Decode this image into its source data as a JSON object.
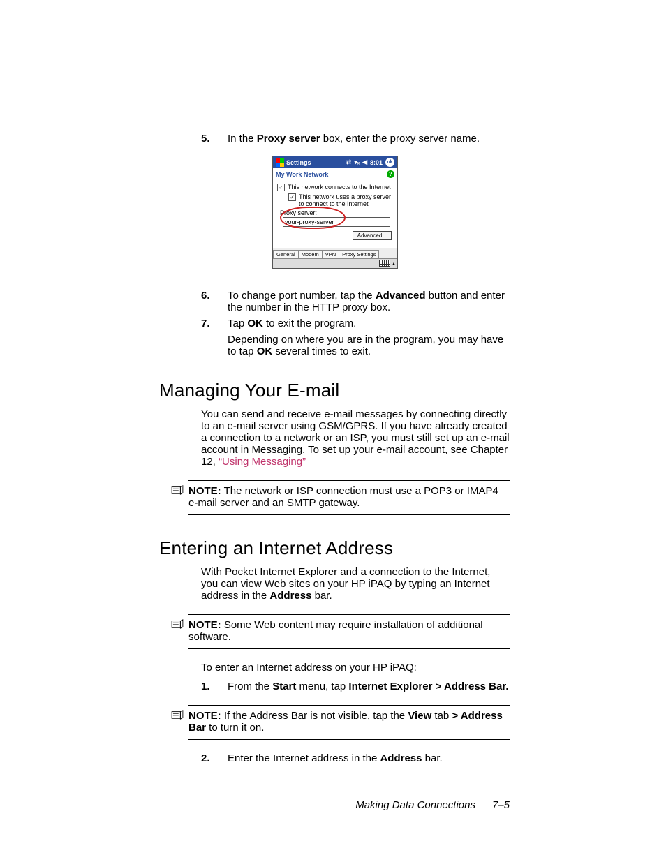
{
  "steps_a": [
    {
      "num": "5.",
      "pre": "In the ",
      "bold1": "Proxy server",
      "post": " box, enter the proxy server name."
    }
  ],
  "device": {
    "title": "Settings",
    "status_time": "8:01",
    "ok": "ok",
    "subtitle": "My Work Network",
    "help": "?",
    "check1": "This network connects to the Internet",
    "check2": "This network uses a proxy server to connect to the Internet",
    "proxy_label": "Proxy server:",
    "proxy_value": "your-proxy-server",
    "advanced": "Advanced...",
    "tabs": [
      "General",
      "Modem",
      "VPN",
      "Proxy Settings"
    ]
  },
  "steps_b": [
    {
      "num": "6.",
      "parts": [
        "To change port number, tap the ",
        "Advanced",
        " button and enter the number in the HTTP proxy box."
      ]
    },
    {
      "num": "7.",
      "parts": [
        "Tap ",
        "OK",
        " to exit the program."
      ],
      "tail": [
        "Depending on where you are in the program, you may have to tap ",
        "OK",
        " several times to exit."
      ]
    }
  ],
  "section1": {
    "title": "Managing Your E-mail",
    "para_parts": [
      "You can send and receive e-mail messages by connecting directly to an e-mail server using GSM/GPRS. If you have already created a connection to a network or an ISP, you must still set up an e-mail account in Messaging. To set up your e-mail account, see Chapter 12, ",
      "“Using Messaging”"
    ],
    "note": {
      "label": "NOTE:",
      "text": " The network or ISP connection must use a POP3 or IMAP4 e-mail server and an SMTP gateway."
    }
  },
  "section2": {
    "title": "Entering an Internet Address",
    "para1_parts": [
      "With Pocket Internet Explorer and a connection to the Internet, you can view Web sites on your HP iPAQ by typing an Internet address in the ",
      "Address",
      " bar."
    ],
    "note1": {
      "label": "NOTE:",
      "text": " Some Web content may require installation of additional software."
    },
    "lead": "To enter an Internet address on your HP iPAQ:",
    "step1": {
      "num": "1.",
      "parts": [
        "From the ",
        "Start",
        " menu, tap ",
        "Internet Explorer > Address Bar."
      ]
    },
    "note2": {
      "label": "NOTE:",
      "parts": [
        " If the Address Bar is not visible, tap the ",
        "View",
        " tab ",
        "> Address Bar",
        " to turn it on."
      ]
    },
    "step2": {
      "num": "2.",
      "parts": [
        "Enter the Internet address in the ",
        "Address",
        " bar."
      ]
    }
  },
  "footer": {
    "chapter": "Making Data Connections",
    "page": "7–5"
  }
}
